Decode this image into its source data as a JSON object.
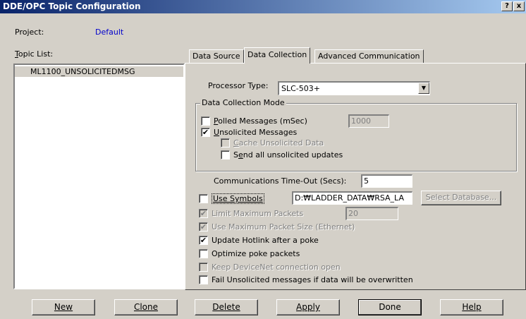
{
  "window": {
    "title": "DDE/OPC Topic Configuration",
    "help_button": "?",
    "close_button": "x"
  },
  "project": {
    "label": "Project:",
    "value": "Default",
    "value_color": "#0000cc"
  },
  "topic_list": {
    "label": "Topic List:",
    "items": [
      "ML1100_UNSOLICITEDMSG"
    ],
    "selected_index": 0
  },
  "tabs": [
    {
      "label": "Data Source",
      "active": false
    },
    {
      "label": "Data Collection",
      "active": true
    },
    {
      "label": "Advanced Communication",
      "active": false
    }
  ],
  "processor": {
    "label": "Processor Type:",
    "value": "SLC-503+"
  },
  "data_collection_mode": {
    "title": "Data Collection Mode",
    "polled": {
      "label": "Polled Messages (mSec)",
      "checked": false,
      "value": "1000"
    },
    "unsolicited": {
      "label": "Unsolicited Messages",
      "checked": true
    },
    "cache": {
      "label": "Cache Unsolicited Data",
      "checked": false,
      "enabled": false
    },
    "send_all": {
      "label": "Send all unsolicited updates",
      "checked": false
    }
  },
  "timeout": {
    "label": "Communications Time-Out (Secs):",
    "value": "5"
  },
  "symbols": {
    "label": "Use Symbols",
    "checked": false,
    "path": "D:₩LADDER_DATA₩RSA_LA",
    "select_db_label": "Select Database..."
  },
  "limit_packets": {
    "label": "Limit Maximum Packets",
    "checked": true,
    "enabled": false,
    "value": "20"
  },
  "max_packet_size": {
    "label": "Use Maximum Packet Size (Ethernet)",
    "checked": true,
    "enabled": false
  },
  "update_hotlink": {
    "label": "Update Hotlink after a poke",
    "checked": true
  },
  "optimize_poke": {
    "label": "Optimize poke packets",
    "checked": false
  },
  "keep_devicenet": {
    "label": "Keep DeviceNet connection open",
    "checked": false,
    "enabled": false
  },
  "fail_unsolicited": {
    "label": "Fail Unsolicited messages if data will be overwritten",
    "checked": false
  },
  "buttons": {
    "new": "New",
    "clone": "Clone",
    "delete": "Delete",
    "apply": "Apply",
    "done": "Done",
    "help": "Help"
  },
  "check_mark": "✔"
}
